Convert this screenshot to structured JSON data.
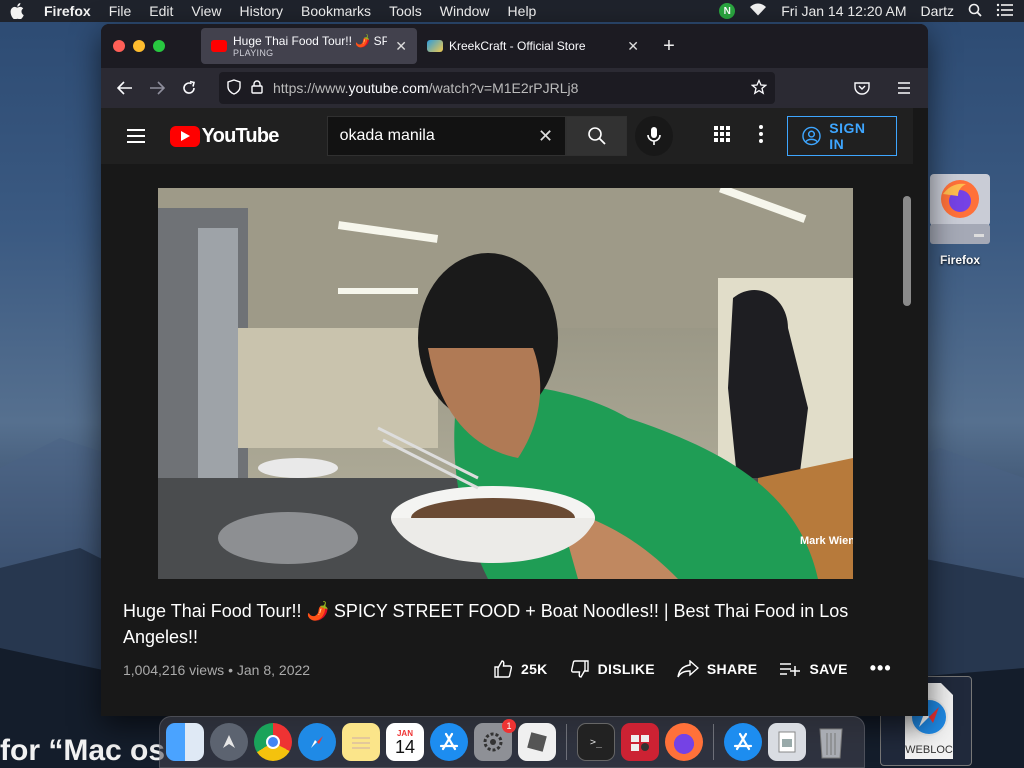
{
  "menubar": {
    "app_name": "Firefox",
    "items": [
      "File",
      "Edit",
      "View",
      "History",
      "Bookmarks",
      "Tools",
      "Window",
      "Help"
    ],
    "status_badge": "N",
    "clock": "Fri Jan 14  12:20 AM",
    "user": "Dartz"
  },
  "browser": {
    "tabs": [
      {
        "title": "Huge Thai Food Tour!! 🌶️ SPICY",
        "subtitle": "PLAYING",
        "active": true
      },
      {
        "title": "KreekCraft - Official Store",
        "active": false
      }
    ],
    "url_prefix": "https://www.",
    "url_host": "youtube.com",
    "url_path": "/watch?v=M1E2rPJRLj8"
  },
  "youtube": {
    "logo_text": "YouTube",
    "search_value": "okada manila",
    "sign_in_label": "SIGN IN",
    "video": {
      "title": "Huge Thai Food Tour!! 🌶️ SPICY STREET FOOD + Boat Noodles!! | Best Thai Food in Los Angeles!!",
      "views": "1,004,216 views",
      "date": "Jan 8, 2022",
      "watermark": "Mark Wiens"
    },
    "actions": {
      "like_count": "25K",
      "dislike_label": "DISLIKE",
      "share_label": "SHARE",
      "save_label": "SAVE"
    }
  },
  "desktop": {
    "firefox_icon_label": "Firefox",
    "webloc_label": "WEBLOC",
    "partial_text": "for “Mac os"
  },
  "dock": {
    "calendar_month": "JAN",
    "calendar_day": "14",
    "settings_badge": "1"
  }
}
